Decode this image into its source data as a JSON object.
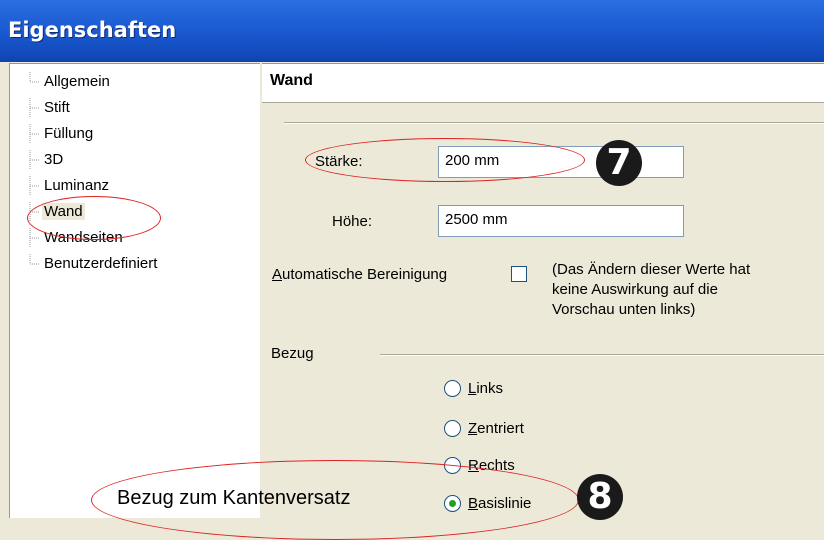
{
  "window": {
    "title": "Eigenschaften"
  },
  "tree": {
    "items": [
      {
        "label": "Allgemein"
      },
      {
        "label": "Stift"
      },
      {
        "label": "Füllung"
      },
      {
        "label": "3D"
      },
      {
        "label": "Luminanz"
      },
      {
        "label": "Wand",
        "selected": true
      },
      {
        "label": "Wandseiten"
      },
      {
        "label": "Benutzerdefiniert"
      }
    ]
  },
  "panel": {
    "title": "Wand",
    "staerke_label": "Stärke:",
    "staerke_value": "200 mm",
    "hoehe_label": "Höhe:",
    "hoehe_value": "2500 mm",
    "auto_cleanup_label": "Automatische Bereinigung",
    "note_lines": [
      "(Das Ändern dieser Werte hat",
      "keine Auswirkung auf die",
      "Vorschau unten links)"
    ],
    "bezug_label": "Bezug",
    "radios": [
      {
        "label": "Links",
        "checked": false
      },
      {
        "label": "Zentriert",
        "checked": false
      },
      {
        "label": "Rechts",
        "checked": false
      },
      {
        "label": "Basislinie",
        "checked": true
      }
    ]
  },
  "annotations": {
    "badge_7": "7",
    "badge_8": "8",
    "callout": "Bezug zum Kantenversatz",
    "ellipse_color": "#dd2222"
  }
}
